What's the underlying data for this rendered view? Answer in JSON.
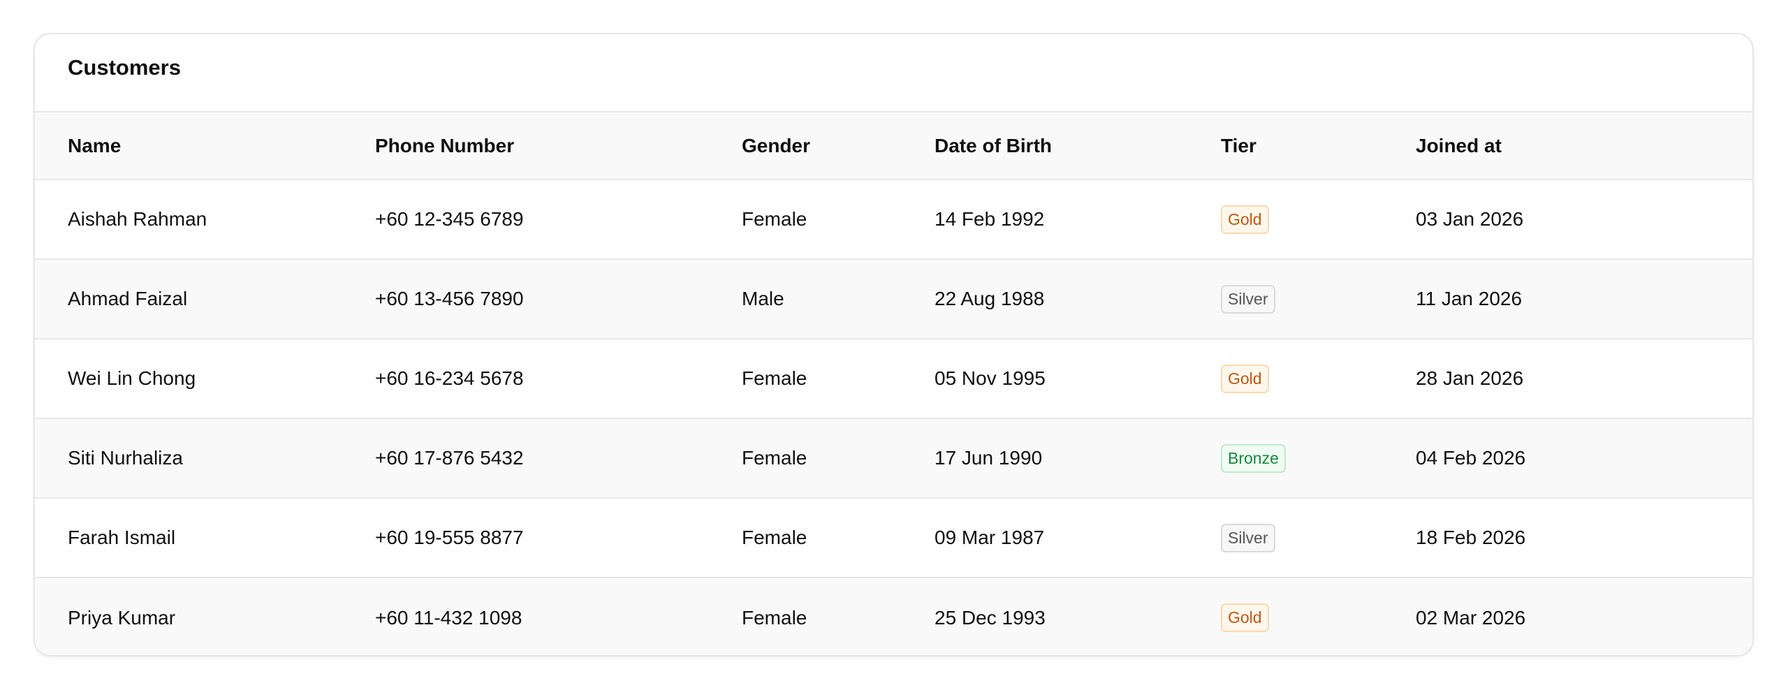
{
  "card": {
    "title": "Customers"
  },
  "table": {
    "headers": {
      "name": "Name",
      "phone": "Phone Number",
      "gender": "Gender",
      "dob": "Date of Birth",
      "tier": "Tier",
      "joined": "Joined at"
    },
    "rows": [
      {
        "name": "Aishah Rahman",
        "phone": "+60 12-345 6789",
        "gender": "Female",
        "dob": "14 Feb 1992",
        "tier": "Gold",
        "joined": "03 Jan 2026"
      },
      {
        "name": "Ahmad Faizal",
        "phone": "+60 13-456 7890",
        "gender": "Male",
        "dob": "22 Aug 1988",
        "tier": "Silver",
        "joined": "11 Jan 2026"
      },
      {
        "name": "Wei Lin Chong",
        "phone": "+60 16-234 5678",
        "gender": "Female",
        "dob": "05 Nov 1995",
        "tier": "Gold",
        "joined": "28 Jan 2026"
      },
      {
        "name": "Siti Nurhaliza",
        "phone": "+60 17-876 5432",
        "gender": "Female",
        "dob": "17 Jun 1990",
        "tier": "Bronze",
        "joined": "04 Feb 2026"
      },
      {
        "name": "Farah Ismail",
        "phone": "+60 19-555 8877",
        "gender": "Female",
        "dob": "09 Mar 1987",
        "tier": "Silver",
        "joined": "18 Feb 2026"
      },
      {
        "name": "Priya Kumar",
        "phone": "+60 11-432 1098",
        "gender": "Female",
        "dob": "25 Dec 1993",
        "tier": "Gold",
        "joined": "02 Mar 2026"
      }
    ]
  },
  "colors": {
    "gold_text": "#c0570e",
    "silver_text": "#555555",
    "bronze_text": "#168a3c",
    "row_stripe": "#f9f9f9",
    "border": "#e8e8e8"
  }
}
